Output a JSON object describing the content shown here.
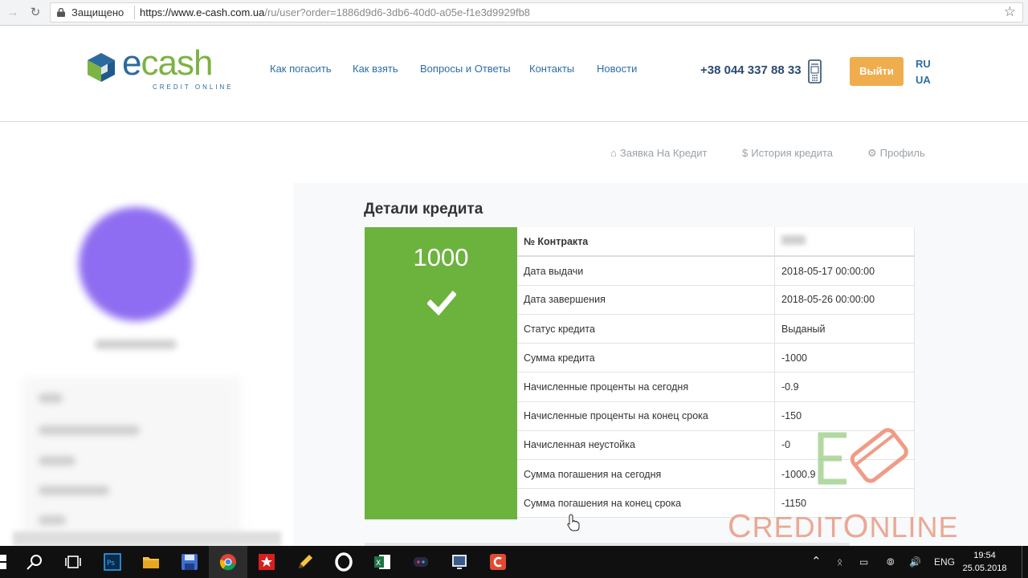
{
  "browser": {
    "secure_label": "Защищено",
    "url_host": "https://www.e-cash.com.ua",
    "url_path": "/ru/user?order=1886d9d6-3db6-40d0-a05e-f1e3d9929fb8"
  },
  "header": {
    "logo_e": "e",
    "logo_cash": "cash",
    "logo_sub": "CREDIT ONLINE",
    "nav": [
      "Как погасить",
      "Как взять",
      "Вопросы и Ответы",
      "Контакты",
      "Новости"
    ],
    "phone": "+38 044 337 88 33",
    "logout_label": "Выйти",
    "languages": [
      "RU",
      "UA"
    ]
  },
  "subnav": {
    "items": [
      {
        "label": "Заявка На Кредит",
        "icon": "home-icon"
      },
      {
        "label": "История кредита",
        "icon": "dollar-icon"
      },
      {
        "label": "Профиль",
        "icon": "gear-icon"
      }
    ]
  },
  "credit": {
    "title": "Детали кредита",
    "amount": "1000",
    "rows": [
      {
        "label": "№ Контракта",
        "value": ""
      },
      {
        "label": "Дата выдачи",
        "value": "2018-05-17 00:00:00"
      },
      {
        "label": "Дата завершения",
        "value": "2018-05-26 00:00:00"
      },
      {
        "label": "Статус кредита",
        "value": "Выданый"
      },
      {
        "label": "Сумма кредита",
        "value": "-1000"
      },
      {
        "label": "Начисленные проценты на сегодня",
        "value": "-0.9"
      },
      {
        "label": "Начисленные проценты на конец срока",
        "value": "-150"
      },
      {
        "label": "Начисленная неустойка",
        "value": "-0"
      },
      {
        "label": "Сумма погашения на сегодня",
        "value": "-1000.9"
      },
      {
        "label": "Сумма погашения на конец срока",
        "value": "-1150"
      }
    ]
  },
  "watermark": {
    "text_a": "C",
    "text_b": "REDIT",
    "text_c": "O",
    "text_d": "NLINE"
  },
  "taskbar": {
    "language": "ENG",
    "time": "19:54",
    "date": "25.05.2018"
  },
  "colors": {
    "brand_blue": "#2b6a9e",
    "brand_green": "#7cb342",
    "card_green": "#6cb33e",
    "button_orange": "#f0ad4e",
    "link_blue": "#2e6da4"
  }
}
